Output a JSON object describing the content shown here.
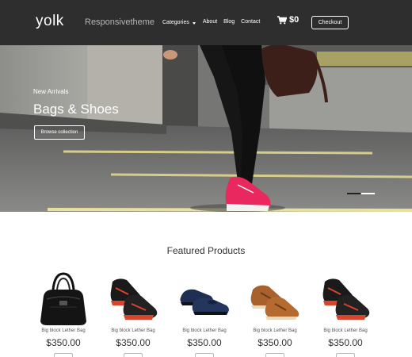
{
  "header": {
    "logo": "yolk",
    "tagline": "Responsivetheme",
    "nav": [
      "Categories",
      "About",
      "Blog",
      "Contact"
    ],
    "cart_amount": "$0",
    "checkout_label": "Checkout"
  },
  "hero": {
    "kicker": "New Arrivals",
    "title": "Bags & Shoes",
    "button_label": "Browse collection",
    "slides": 2,
    "active_slide": 1
  },
  "featured": {
    "title": "Featured Products",
    "products": [
      {
        "name": "Big block Lether Bag",
        "price": "$350.00",
        "image": "black-handbag"
      },
      {
        "name": "Big block Lether Bag",
        "price": "$350.00",
        "image": "black-red-sneakers"
      },
      {
        "name": "Big block Lether Bag",
        "price": "$350.00",
        "image": "navy-loafers"
      },
      {
        "name": "Big block Lether Bag",
        "price": "$350.00",
        "image": "brown-lace-up-shoes"
      },
      {
        "name": "Big block Lether Bag",
        "price": "$350.00",
        "image": "black-red-sneakers"
      }
    ]
  }
}
